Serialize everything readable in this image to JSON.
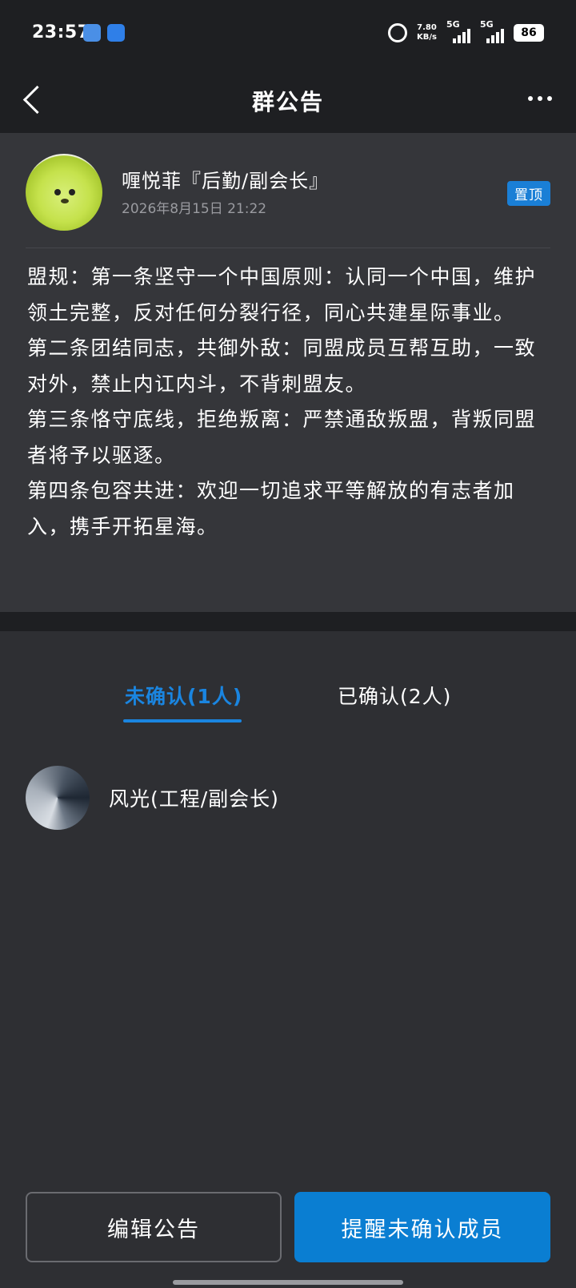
{
  "status_bar": {
    "time": "23:57",
    "net_speed_value": "7.80",
    "net_speed_unit": "KB/s",
    "signal1_label": "5G",
    "signal2_label": "5G",
    "battery": "86"
  },
  "header": {
    "title": "群公告"
  },
  "announcement": {
    "author": "喱悦菲『后勤/副会长』",
    "date": "2026年8月15日 21:22",
    "pin_label": "置顶",
    "paragraphs": [
      "盟规：第一条坚守一个中国原则：认同一个中国，维护领土完整，反对任何分裂行径，同心共建星际事业。",
      "第二条团结同志，共御外敌：同盟成员互帮互助，一致对外，禁止内讧内斗，不背刺盟友。",
      "第三条恪守底线，拒绝叛离：严禁通敌叛盟，背叛同盟者将予以驱逐。",
      "第四条包容共进：欢迎一切追求平等解放的有志者加入，携手开拓星海。"
    ]
  },
  "tabs": {
    "unconfirmed": "未确认(1人)",
    "confirmed": "已确认(2人)"
  },
  "members": [
    {
      "name": "风光(工程/副会长)"
    }
  ],
  "buttons": {
    "edit": "编辑公告",
    "remind": "提醒未确认成员"
  },
  "colors": {
    "accent": "#1a85e0",
    "background": "#2e2f33",
    "header_bg": "#1e1f22"
  }
}
